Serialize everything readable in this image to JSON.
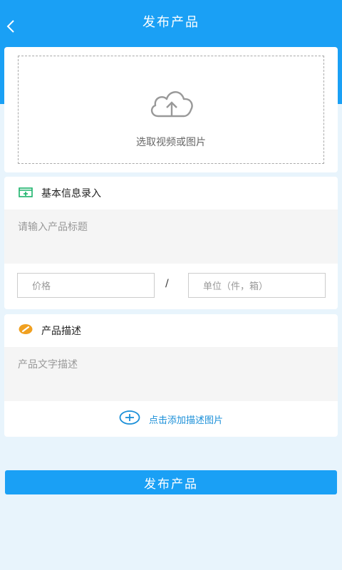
{
  "header": {
    "title": "发布产品"
  },
  "upload": {
    "label": "选取视频或图片"
  },
  "basic_info": {
    "section_title": "基本信息录入",
    "title_placeholder": "请输入产品标题",
    "price_placeholder": "价格",
    "separator": "/",
    "unit_placeholder": "单位（件，箱）"
  },
  "description": {
    "section_title": "产品描述",
    "text_placeholder": "产品文字描述",
    "add_image_label": "点击添加描述图片"
  },
  "submit": {
    "label": "发布产品"
  },
  "colors": {
    "primary": "#1aa0f5",
    "page_background": "#e8f4fc",
    "info_icon_green": "#1bb36b",
    "desc_icon_orange": "#f0a020",
    "link_blue": "#1a8fd8"
  }
}
